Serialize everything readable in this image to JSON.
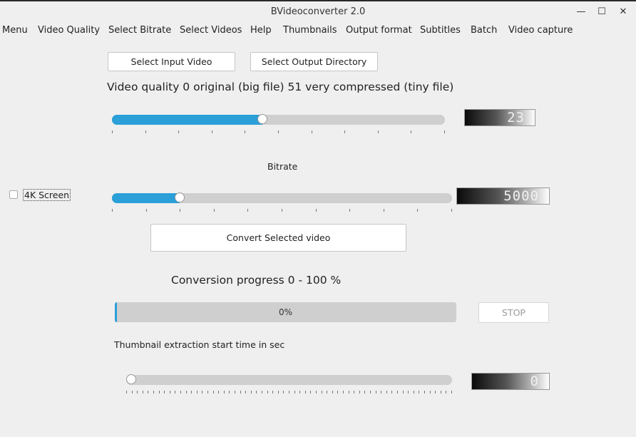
{
  "window": {
    "title": "BVideoconverter 2.0",
    "minimize": "—",
    "maximize": "☐",
    "close": "✕"
  },
  "menu": [
    "Menu",
    "Video Quality",
    "Select Bitrate",
    "Select Videos",
    "Help",
    "Thumbnails",
    "Output format",
    "Subtitles",
    "Batch",
    "Video capture"
  ],
  "buttons": {
    "select_input": "Select Input Video",
    "select_output": "Select Output Directory",
    "convert": "Convert Selected video",
    "stop": "STOP"
  },
  "quality": {
    "label": "Video quality 0 original (big file) 51 very compressed (tiny file)",
    "value": 23,
    "min": 0,
    "max": 51,
    "display": "23"
  },
  "bitrate": {
    "label": "Bitrate",
    "value": 5000,
    "min": 0,
    "max": 25000,
    "display": "5000"
  },
  "checkbox_4k": {
    "label": "4K Screen",
    "checked": false
  },
  "progress": {
    "label": "Conversion progress 0 - 100 %",
    "value": 0,
    "text": "0%"
  },
  "thumbnail": {
    "label": "Thumbnail extraction start time in sec",
    "value": 0,
    "display": "0"
  },
  "colors": {
    "accent": "#2a9fd8",
    "groove": "#cfcfcf",
    "background": "#efefef"
  }
}
